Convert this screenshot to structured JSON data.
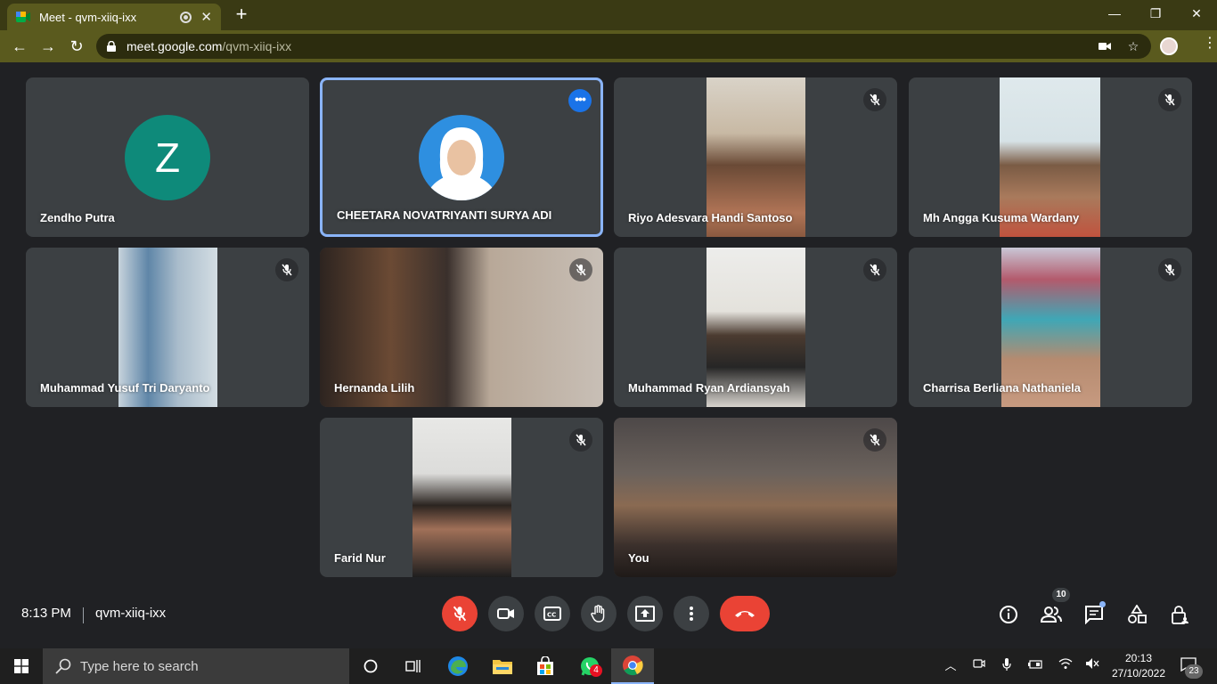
{
  "browser": {
    "tab_title": "Meet - qvm-xiiq-ixx",
    "url_host": "meet.google.com",
    "url_path": "/qvm-xiiq-ixx"
  },
  "participants": [
    {
      "name": "Zendho Putra",
      "avatar_letter": "Z"
    },
    {
      "name": "CHEETARA NOVATRIYANTI SURYA ADI"
    },
    {
      "name": "Riyo Adesvara Handi Santoso"
    },
    {
      "name": "Mh Angga Kusuma Wardany"
    },
    {
      "name": "Muhammad Yusuf Tri Daryanto"
    },
    {
      "name": "Hernanda Lilih"
    },
    {
      "name": "Muhammad Ryan Ardiansyah"
    },
    {
      "name": "Charrisa Berliana Nathaniela"
    },
    {
      "name": "Farid Nur"
    },
    {
      "name": "You"
    }
  ],
  "meeting": {
    "time": "8:13 PM",
    "code": "qvm-xiiq-ixx",
    "people_count": "10"
  },
  "taskbar": {
    "search_placeholder": "Type here to search",
    "time": "20:13",
    "date": "27/10/2022",
    "whatsapp_badge": "4",
    "notifications_badge": "23"
  },
  "colors": {
    "meet_bg": "#202124",
    "tile_bg": "#3c4043",
    "end_call_red": "#ea4335",
    "active_speaker_border": "#8ab4f8",
    "avatar_teal": "#0e8a7a"
  }
}
